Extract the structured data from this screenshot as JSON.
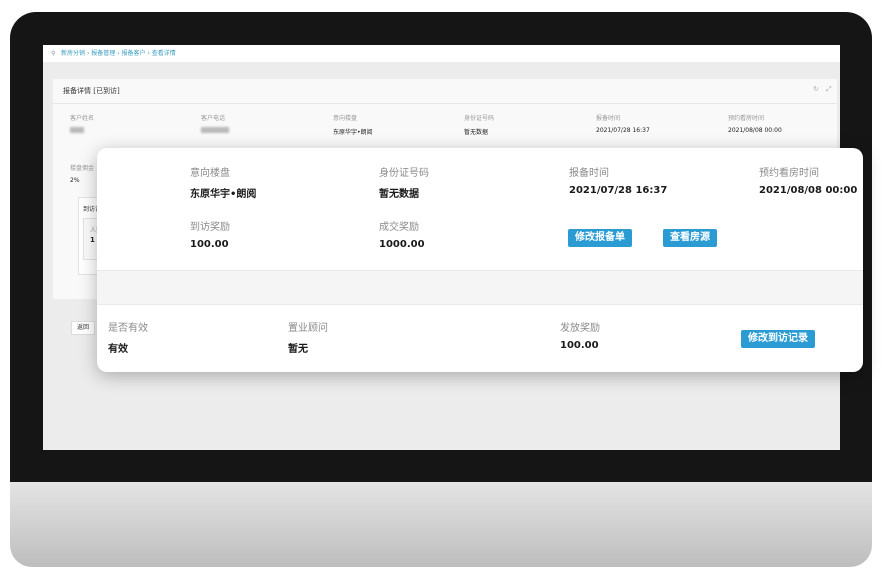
{
  "breadcrumb": {
    "items": [
      "新房分销",
      "报备管理",
      "报备客户",
      "查看详情"
    ],
    "separator": "›"
  },
  "detail": {
    "title": "报备详情 [已到访]",
    "fields": {
      "customer_name": {
        "label": "客户姓名",
        "value": ""
      },
      "customer_phone": {
        "label": "客户电话",
        "value": ""
      },
      "property": {
        "label": "意向楼盘",
        "value": "东原华宇•朗阅"
      },
      "id_number": {
        "label": "身份证号码",
        "value": "暂无数据"
      },
      "report_time": {
        "label": "报备时间",
        "value": "2021/07/28 16:37"
      },
      "visit_time": {
        "label": "预约看房时间",
        "value": "2021/08/08 00:00"
      },
      "commission": {
        "label": "楼盘佣金",
        "value": "2%"
      }
    },
    "visit_section_title": "到访记",
    "visit_inner_label": "人数",
    "visit_inner_value": "1",
    "back_button": "返回"
  },
  "card": {
    "property": {
      "label": "意向楼盘",
      "value": "东原华宇•朗阅"
    },
    "id_number": {
      "label": "身份证号码",
      "value": "暂无数据"
    },
    "report_time": {
      "label": "报备时间",
      "value": "2021/07/28 16:37"
    },
    "visit_time": {
      "label": "预约看房时间",
      "value": "2021/08/08 00:00"
    },
    "visit_reward": {
      "label": "到访奖励",
      "value": "100.00"
    },
    "deal_reward": {
      "label": "成交奖励",
      "value": "1000.00"
    },
    "edit_report_button": "修改报备单",
    "view_house_button": "查看房源",
    "valid": {
      "label": "是否有效",
      "value": "有效"
    },
    "consultant": {
      "label": "置业顾问",
      "value": "暂无"
    },
    "issued_reward": {
      "label": "发放奖励",
      "value": "100.00"
    },
    "edit_visit_button": "修改到访记录"
  },
  "colors": {
    "accent": "#2b9bd3",
    "bezel": "#151515"
  }
}
